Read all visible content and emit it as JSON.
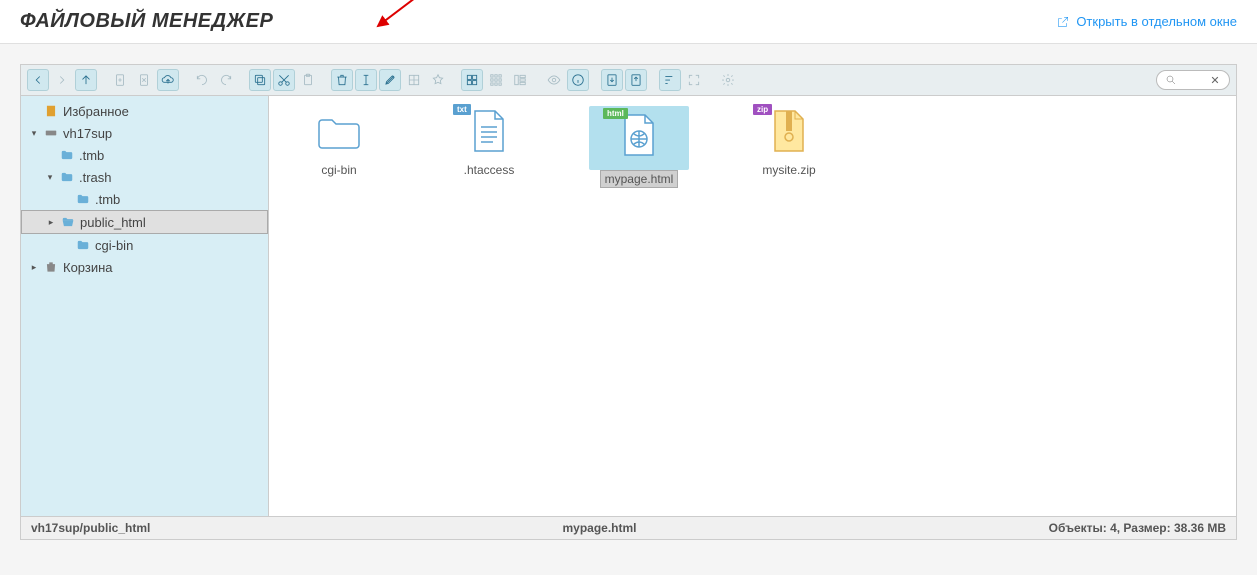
{
  "header": {
    "title": "ФАЙЛОВЫЙ МЕНЕДЖЕР",
    "open_window": "Открыть в отдельном окне"
  },
  "toolbar": {
    "groups": [
      [
        {
          "name": "back-icon",
          "enabled": true,
          "svg": "arrow-left"
        },
        {
          "name": "forward-icon",
          "enabled": false,
          "svg": "arrow-right"
        },
        {
          "name": "up-icon",
          "enabled": true,
          "svg": "arrow-up"
        }
      ],
      [
        {
          "name": "newfile-icon",
          "enabled": false,
          "svg": "file-plus"
        },
        {
          "name": "newfolder-icon",
          "enabled": false,
          "svg": "file-x"
        },
        {
          "name": "upload-icon",
          "enabled": true,
          "svg": "cloud-up"
        }
      ],
      [
        {
          "name": "undo-icon",
          "enabled": false,
          "svg": "undo"
        },
        {
          "name": "redo-icon",
          "enabled": false,
          "svg": "redo"
        }
      ],
      [
        {
          "name": "copy-icon",
          "enabled": true,
          "svg": "copy"
        },
        {
          "name": "cut-icon",
          "enabled": true,
          "svg": "cut"
        },
        {
          "name": "paste-icon",
          "enabled": false,
          "svg": "paste"
        }
      ],
      [
        {
          "name": "delete-icon",
          "enabled": true,
          "svg": "trash"
        },
        {
          "name": "rename-icon",
          "enabled": true,
          "svg": "rename"
        },
        {
          "name": "edit-icon",
          "enabled": true,
          "svg": "edit"
        },
        {
          "name": "resize-icon",
          "enabled": false,
          "svg": "resize"
        },
        {
          "name": "places-icon",
          "enabled": false,
          "svg": "star"
        }
      ],
      [
        {
          "name": "view-icons-icon",
          "enabled": true,
          "svg": "grid-large"
        },
        {
          "name": "view-small-icon",
          "enabled": false,
          "svg": "grid-small"
        },
        {
          "name": "view-list-icon",
          "enabled": false,
          "svg": "list-cols"
        }
      ],
      [
        {
          "name": "preview-icon",
          "enabled": false,
          "svg": "eye"
        },
        {
          "name": "info-icon",
          "enabled": true,
          "svg": "info"
        }
      ],
      [
        {
          "name": "download-icon",
          "enabled": true,
          "svg": "download"
        },
        {
          "name": "open-icon",
          "enabled": true,
          "svg": "open"
        }
      ],
      [
        {
          "name": "sort-icon",
          "enabled": true,
          "svg": "sort"
        },
        {
          "name": "fullscreen-icon",
          "enabled": false,
          "svg": "fullscreen"
        }
      ],
      [
        {
          "name": "settings-icon",
          "enabled": false,
          "svg": "gear"
        }
      ]
    ]
  },
  "tree": [
    {
      "indent": 0,
      "toggle": "",
      "icon": "favorites",
      "label": "Избранное",
      "selected": false
    },
    {
      "indent": 0,
      "toggle": "▾",
      "icon": "disk",
      "label": "vh17sup",
      "selected": false
    },
    {
      "indent": 1,
      "toggle": "",
      "icon": "folder",
      "label": ".tmb",
      "selected": false
    },
    {
      "indent": 1,
      "toggle": "▾",
      "icon": "folder",
      "label": ".trash",
      "selected": false
    },
    {
      "indent": 2,
      "toggle": "",
      "icon": "folder",
      "label": ".tmb",
      "selected": false
    },
    {
      "indent": 1,
      "toggle": "▸",
      "icon": "folder-open",
      "label": "public_html",
      "selected": true
    },
    {
      "indent": 2,
      "toggle": "",
      "icon": "folder",
      "label": "cgi-bin",
      "selected": false
    },
    {
      "indent": 0,
      "toggle": "▸",
      "icon": "trash",
      "label": "Корзина",
      "selected": false
    }
  ],
  "files": [
    {
      "name": "cgi-bin",
      "type": "folder",
      "selected": false
    },
    {
      "name": ".htaccess",
      "type": "txt",
      "selected": false
    },
    {
      "name": "mypage.html",
      "type": "html",
      "selected": true
    },
    {
      "name": "mysite.zip",
      "type": "zip",
      "selected": false
    }
  ],
  "statusbar": {
    "path": "vh17sup/public_html",
    "current": "mypage.html",
    "stats": "Объекты: 4, Размер: 38.36 MB"
  }
}
